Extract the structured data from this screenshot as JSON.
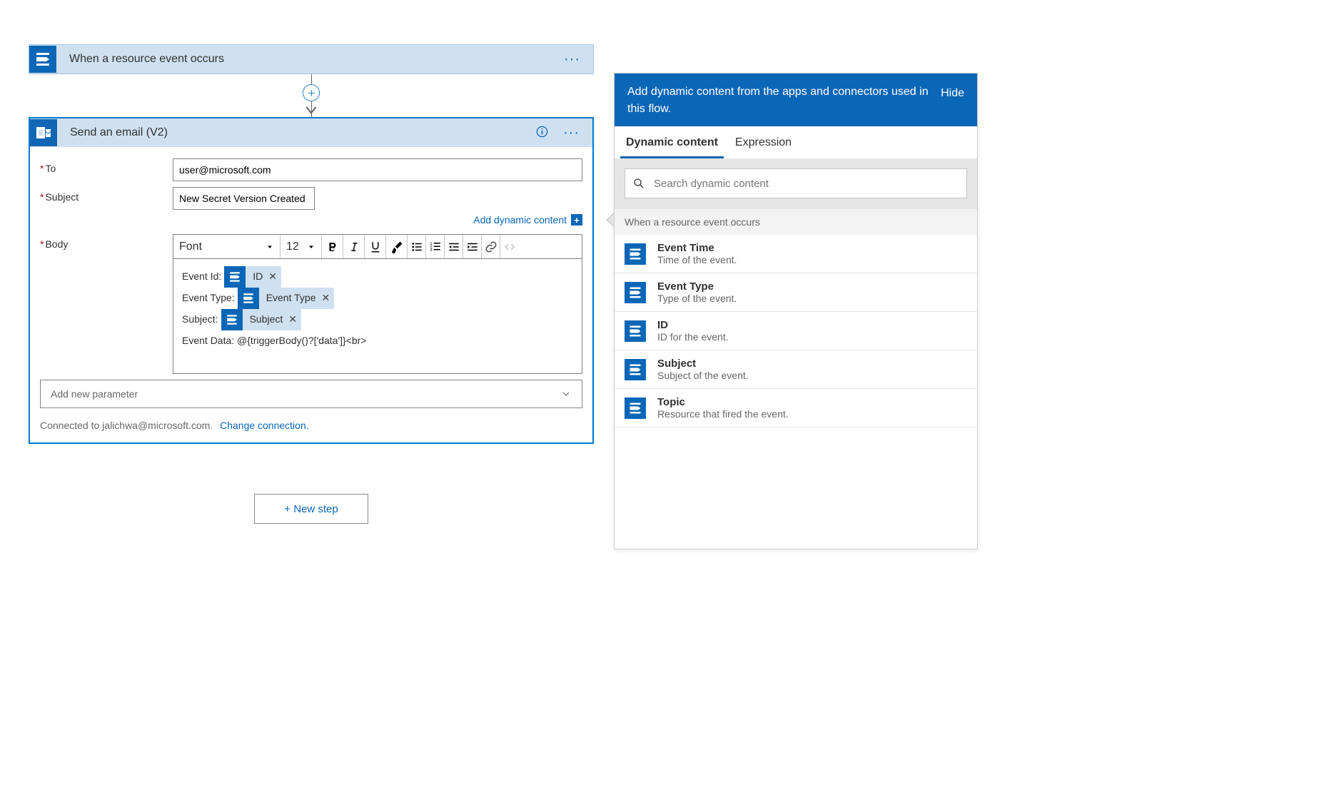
{
  "trigger": {
    "title": "When a resource event occurs",
    "ellipsis": "···"
  },
  "action": {
    "title": "Send an email (V2)",
    "ellipsis": "···",
    "fields": {
      "to": {
        "label": "To",
        "value": "user@microsoft.com"
      },
      "subject": {
        "label": "Subject",
        "value": "New Secret Version Created "
      },
      "body": {
        "label": "Body"
      }
    },
    "add_dynamic_content": "Add dynamic content",
    "toolbar": {
      "font_label": "Font",
      "size": "12"
    },
    "body_content": {
      "line1_label": "Event Id: ",
      "line1_token": "ID",
      "line2_label": "Event Type: ",
      "line2_token": "Event Type",
      "line3_label": "Subject: ",
      "line3_token": "Subject",
      "line4": "Event Data: @{triggerBody()?['data']}<br>"
    },
    "add_new_parameter": "Add new parameter",
    "connected_to": "Connected to jalichwa@microsoft.com.",
    "change_connection": "Change connection."
  },
  "new_step": "+ New step",
  "panel": {
    "head_text": "Add dynamic content from the apps and connectors used in this flow.",
    "hide": "Hide",
    "tabs": {
      "dynamic": "Dynamic content",
      "expression": "Expression"
    },
    "search_placeholder": "Search dynamic content",
    "section_title": "When a resource event occurs",
    "items": [
      {
        "title": "Event Time",
        "sub": "Time of the event."
      },
      {
        "title": "Event Type",
        "sub": "Type of the event."
      },
      {
        "title": "ID",
        "sub": "ID for the event."
      },
      {
        "title": "Subject",
        "sub": "Subject of the event."
      },
      {
        "title": "Topic",
        "sub": "Resource that fired the event."
      }
    ]
  }
}
